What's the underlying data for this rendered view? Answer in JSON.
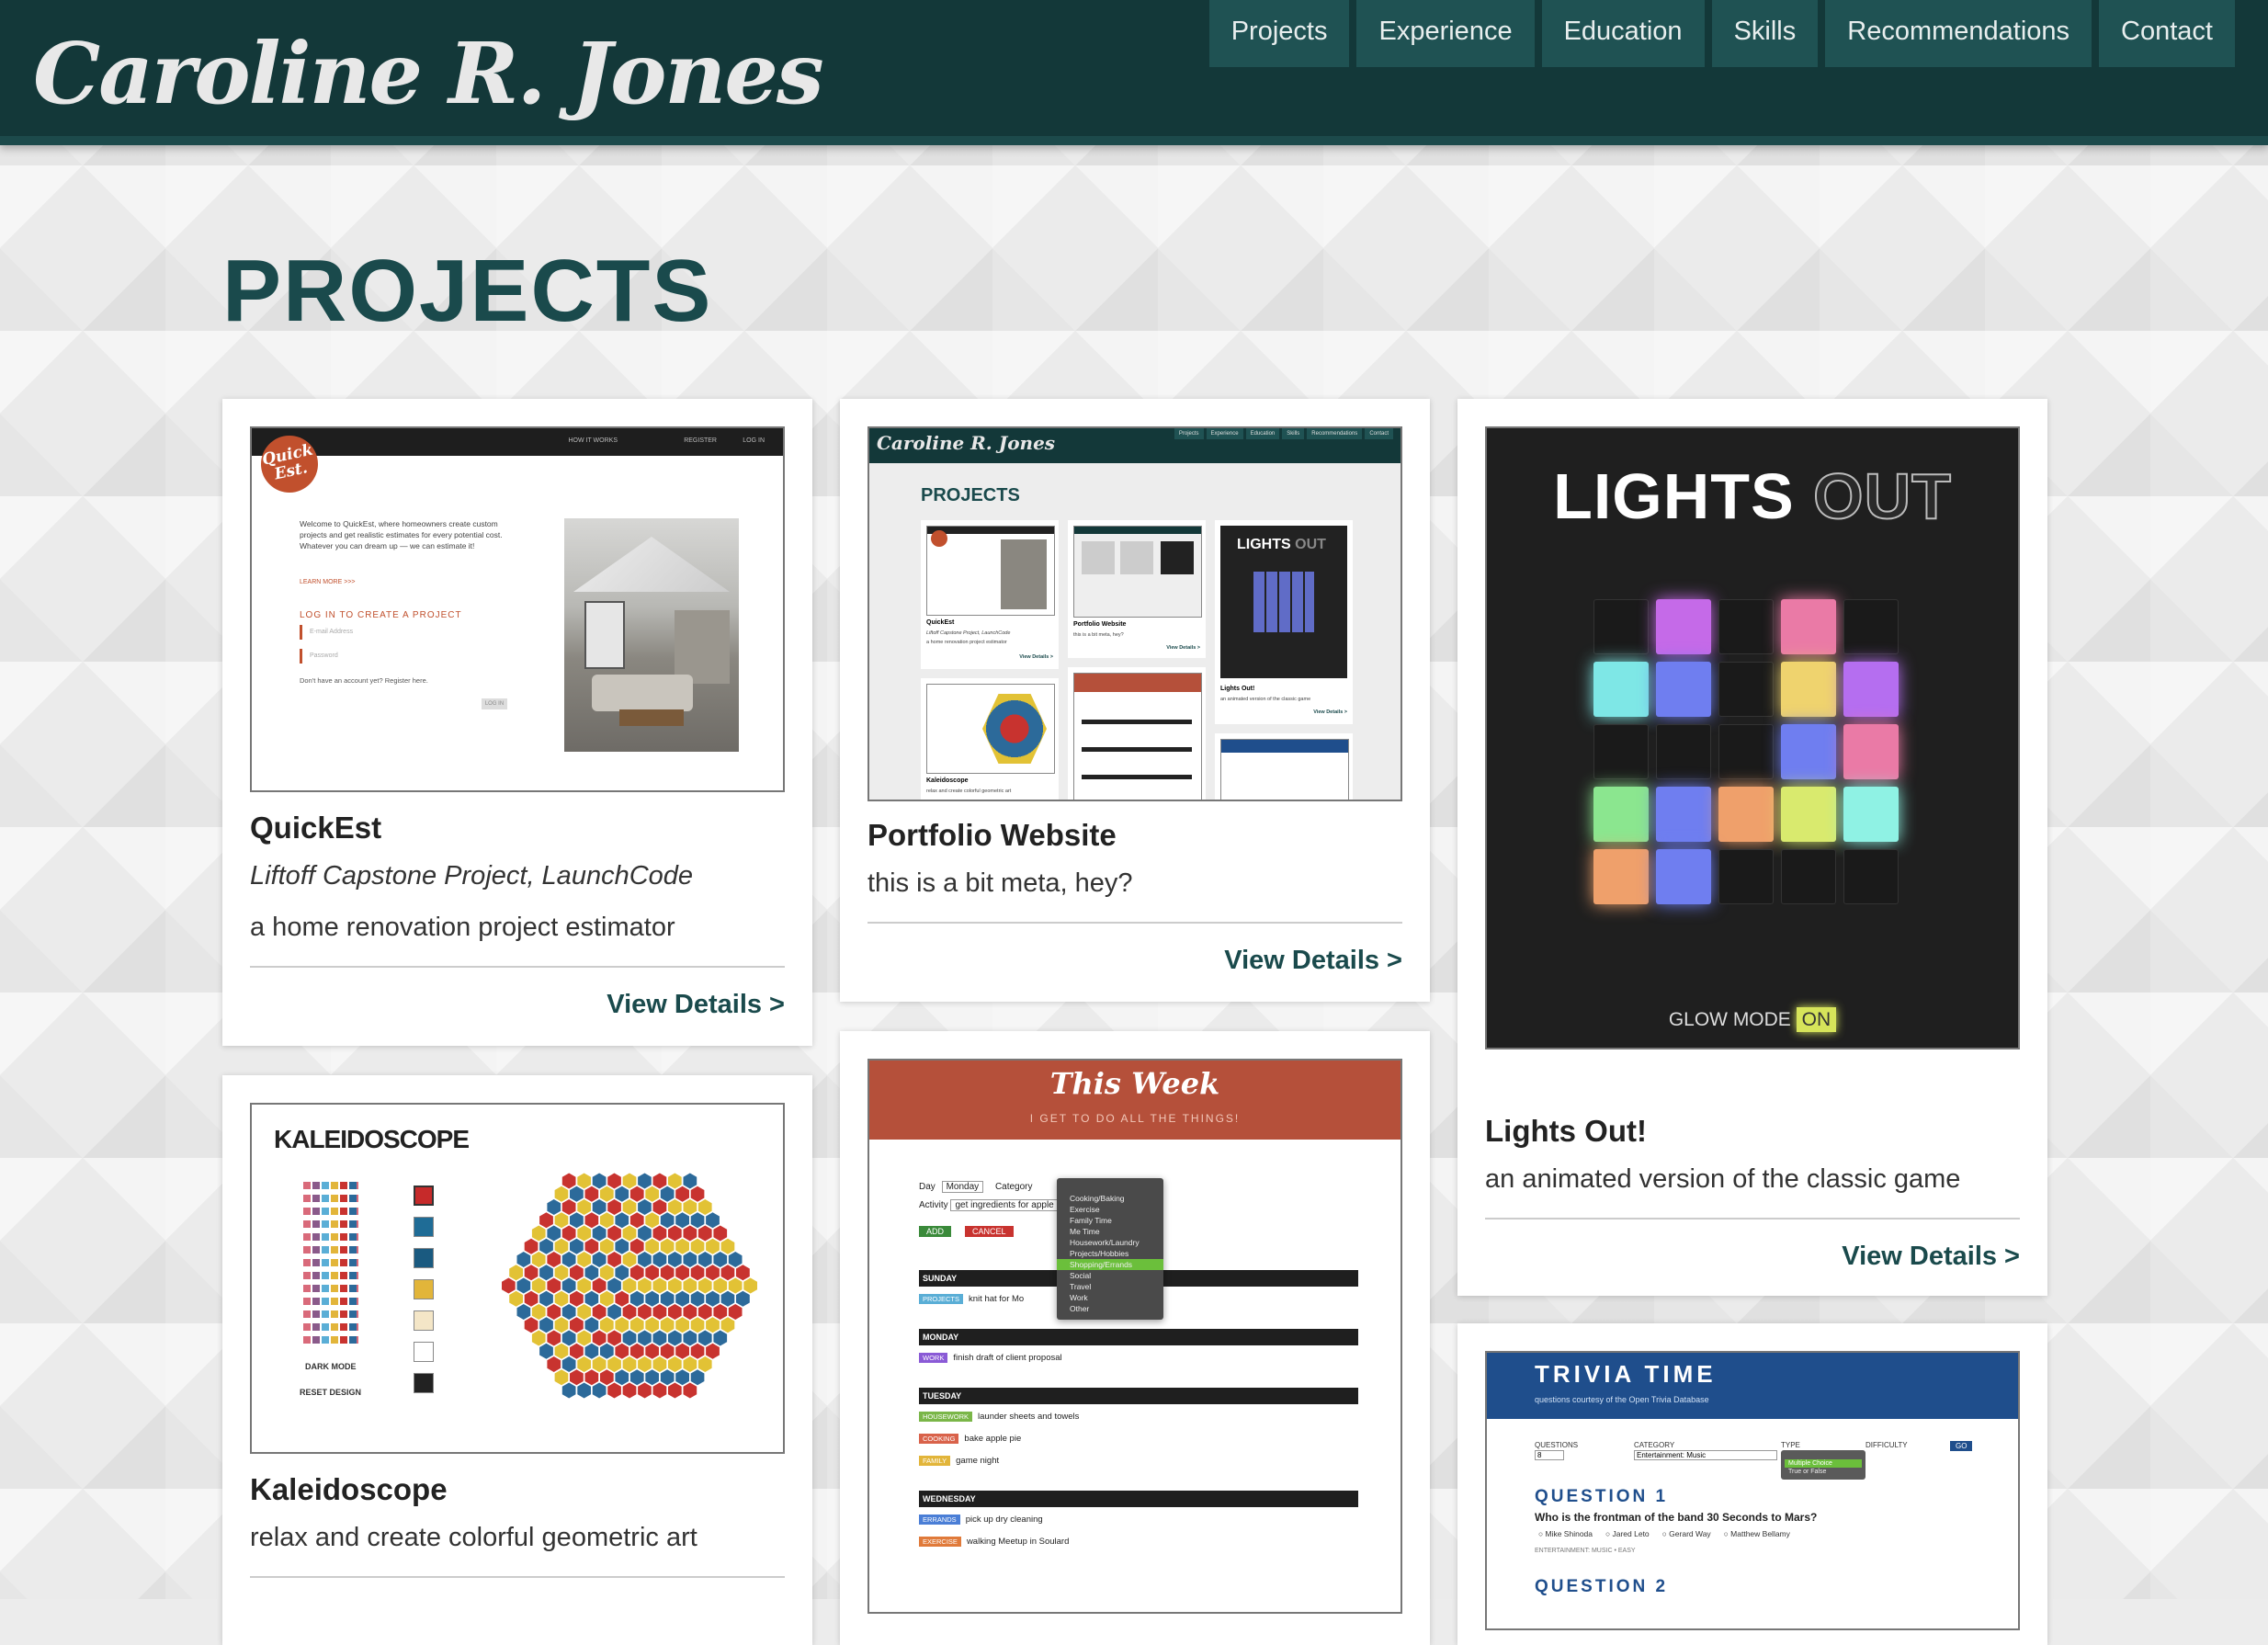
{
  "site": {
    "logo": "Caroline R. Jones"
  },
  "nav": [
    "Projects",
    "Experience",
    "Education",
    "Skills",
    "Recommendations",
    "Contact"
  ],
  "page": {
    "title": "PROJECTS"
  },
  "projects": [
    {
      "title": "QuickEst",
      "subtitle": "Liftoff Capstone Project, LaunchCode",
      "description": "a home renovation project estimator",
      "link": "View Details >"
    },
    {
      "title": "Portfolio Website",
      "description": "this is a bit meta, hey?",
      "link": "View Details >"
    },
    {
      "title": "Lights Out!",
      "description": "an animated version of the classic game",
      "link": "View Details >"
    },
    {
      "title": "Kaleidoscope",
      "description": "relax and create colorful geometric art"
    },
    {
      "title": "This Week"
    },
    {
      "title": "Trivia Time"
    }
  ],
  "thumbs": {
    "quickest": {
      "logo": "Quick Est.",
      "nav": [
        "HOW IT WORKS",
        "REGISTER",
        "LOG IN"
      ],
      "intro": "Welcome to QuickEst, where homeowners create custom projects and get realistic estimates for every potential cost. Whatever you can dream up — we can estimate it!",
      "learn_more": "LEARN MORE >>>",
      "cta": "LOG IN TO CREATE A PROJECT",
      "email_placeholder": "E-mail Address",
      "password_placeholder": "Password",
      "register_text": "Don't have an account yet? Register here.",
      "login_button": "LOG IN"
    },
    "portfolio": {
      "logo": "Caroline R. Jones",
      "nav": [
        "Projects",
        "Experience",
        "Education",
        "Skills",
        "Recommendations",
        "Contact"
      ],
      "heading": "PROJECTS",
      "mini_cards": [
        {
          "title": "QuickEst",
          "sub": "Liftoff Capstone Project, LaunchCode",
          "desc": "a home renovation project estimator",
          "link": "View Details >"
        },
        {
          "title": "Portfolio Website",
          "desc": "this is a bit meta, hey?",
          "link": "View Details >"
        },
        {
          "title": "Lights Out!",
          "desc": "an animated version of the classic game",
          "link": "View Details >"
        },
        {
          "title": "Kaleidoscope",
          "desc": "relax and create colorful geometric art"
        }
      ]
    },
    "lights": {
      "title_a": "LIGHTS",
      "title_b": "OUT",
      "glow_label": "GLOW MODE",
      "glow_state": "ON",
      "grid": [
        [
          "off",
          "#c56ae8",
          "off",
          "#ea7aa6",
          "off"
        ],
        [
          "#7ee7e6",
          "#6f7ef0",
          "off",
          "#efd36e",
          "#b56ef0"
        ],
        [
          "off",
          "off",
          "off",
          "#6f7ef0",
          "#ea7aa6"
        ],
        [
          "#8be68f",
          "#6f7ef0",
          "#efa06b",
          "#d9ea6e",
          "#8ff2e4"
        ],
        [
          "#efa06b",
          "#6f7ef0",
          "off",
          "off",
          "off"
        ]
      ]
    },
    "kaleidoscope": {
      "title": "KALEIDOSCOPE",
      "dark_mode": "DARK MODE",
      "reset": "RESET DESIGN",
      "swatches": [
        "#c62a2a",
        "#1f6c96",
        "#1a5a80",
        "#e2b53a",
        "#f4e6c7",
        "#ffffff",
        "#222222"
      ],
      "hex_colors": [
        "#e2c235",
        "#c8332f",
        "#2c6a9a"
      ]
    },
    "thisweek": {
      "title": "This Week",
      "tagline": "I GET TO DO ALL THE THINGS!",
      "day_label": "Day",
      "day_value": "Monday",
      "category_label": "Category",
      "activity_label": "Activity",
      "activity_value": "get ingredients for apple",
      "add": "ADD",
      "cancel": "CANCEL",
      "categories": [
        "Cooking/Baking",
        "Exercise",
        "Family Time",
        "Me Time",
        "Housework/Laundry",
        "Projects/Hobbies",
        "Shopping/Errands",
        "Social",
        "Travel",
        "Work",
        "Other"
      ],
      "days": [
        {
          "name": "SUNDAY",
          "items": [
            {
              "tag": "PROJECTS",
              "color": "#5aaed6",
              "text": "knit hat for Mo"
            }
          ]
        },
        {
          "name": "MONDAY",
          "items": [
            {
              "tag": "WORK",
              "color": "#8a5ad6",
              "text": "finish draft of client proposal"
            }
          ]
        },
        {
          "name": "TUESDAY",
          "items": [
            {
              "tag": "HOUSEWORK",
              "color": "#7ab648",
              "text": "launder sheets and towels"
            },
            {
              "tag": "COOKING",
              "color": "#d9624a",
              "text": "bake apple pie"
            },
            {
              "tag": "FAMILY",
              "color": "#e2b53a",
              "text": "game night"
            }
          ]
        },
        {
          "name": "WEDNESDAY",
          "items": [
            {
              "tag": "ERRANDS",
              "color": "#4a7ed6",
              "text": "pick up dry cleaning"
            },
            {
              "tag": "EXERCISE",
              "color": "#e07a3a",
              "text": "walking Meetup in Soulard"
            }
          ]
        }
      ]
    },
    "trivia": {
      "title": "TRIVIA TIME",
      "credit": "questions courtesy of the Open Trivia Database",
      "questions_label": "QUESTIONS",
      "questions_value": "8",
      "category_label": "CATEGORY",
      "category_value": "Entertainment: Music",
      "type_label": "TYPE",
      "type_options": [
        "Multiple Choice",
        "True or False"
      ],
      "difficulty_label": "DIFFICULTY",
      "go": "GO",
      "question1_label": "QUESTION 1",
      "question1_text": "Who is the frontman of the band 30 Seconds to Mars?",
      "answers": [
        "Mike Shinoda",
        "Jared Leto",
        "Gerard Way",
        "Matthew Bellamy"
      ],
      "meta": "ENTERTAINMENT: MUSIC • EASY",
      "question2_label": "QUESTION 2"
    }
  }
}
